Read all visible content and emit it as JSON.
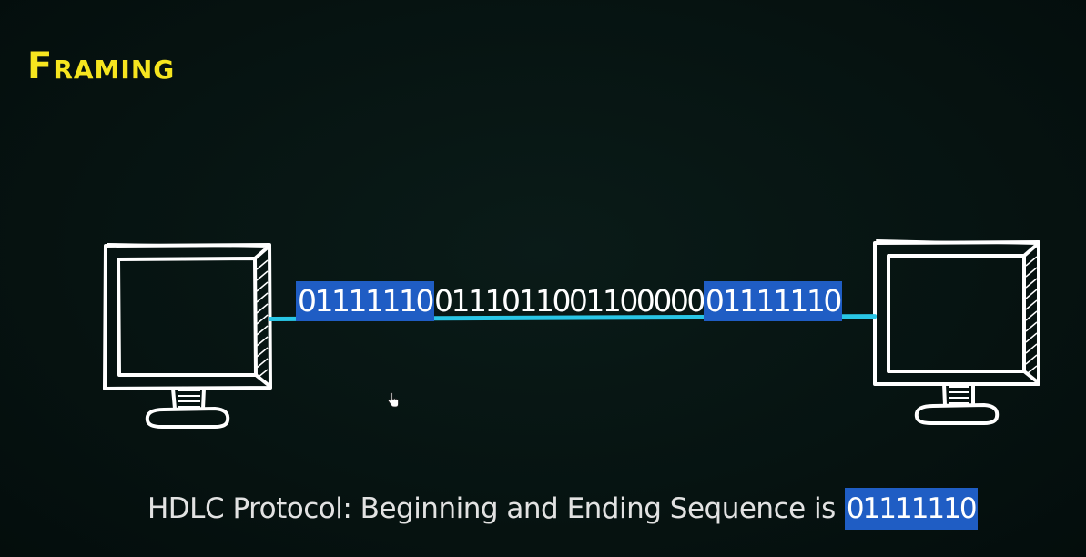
{
  "title": "Framing",
  "frame": {
    "start_flag": "01111110",
    "payload": "0111011001100000",
    "end_flag": "01111110"
  },
  "caption": {
    "text": "HDLC Protocol: Beginning and Ending Sequence is",
    "sequence": "01111110"
  },
  "colors": {
    "background": "#071512",
    "title": "#f6e51f",
    "highlight": "#1f5dc4",
    "link": "#29c6e6",
    "sketch": "#ffffff"
  }
}
